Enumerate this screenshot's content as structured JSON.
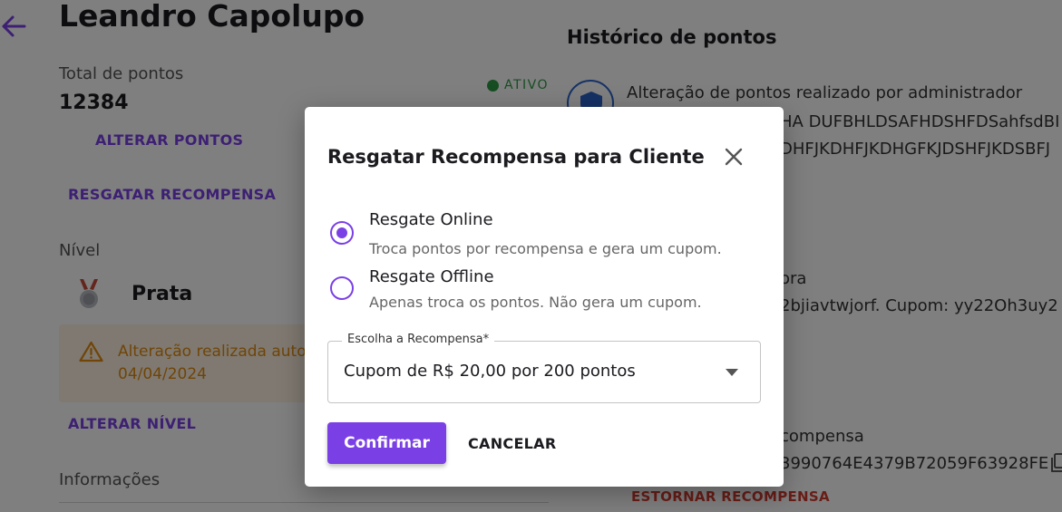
{
  "customer": {
    "name": "Leandro Capolupo",
    "total_points_label": "Total de pontos",
    "total_points_value": "12384",
    "status": "ATIVO",
    "status_color": "#2e9a47"
  },
  "actions": {
    "alter_points": "ALTERAR PONTOS",
    "redeem_reward": "RESGATAR RECOMPENSA",
    "alter_level": "ALTERAR NÍVEL"
  },
  "level": {
    "label": "Nível",
    "name": "Prata",
    "notice_line1": "Alteração realizada autom",
    "notice_line2": "04/04/2024"
  },
  "info": {
    "label": "Informações"
  },
  "history": {
    "title": "Histórico de pontos",
    "entry1_title": "Alteração de pontos realizado por administrador",
    "entry1_line2": "HA DUFBHLDSAFHDSHFDSahfsdBI",
    "entry1_line3": "DHFJKDHFJKDHGFKJDSHFJKDSBFJ",
    "entry2_title_fragment": "ora",
    "entry2_detail_fragment": "2bjiavtwjorf. Cupom: yy22Oh3uy2",
    "entry3_title_fragment": "compensa",
    "entry3_code_fragment": "3990764E4379B72059F63928FE",
    "undo_label": "ESTORNAR RECOMPENSA"
  },
  "dialog": {
    "title": "Resgatar Recompensa para Cliente",
    "option_online_label": "Resgate Online",
    "option_online_desc": "Troca pontos por recompensa e gera um cupom.",
    "option_offline_label": "Resgate Offline",
    "option_offline_desc": "Apenas troca os pontos. Não gera um cupom.",
    "selected_option": "Resgate Online",
    "select_label": "Escolha a Recompensa*",
    "select_value": "Cupom de R$ 20,00 por 200 pontos",
    "confirm_label": "Confirmar",
    "cancel_label": "CANCELAR"
  },
  "colors": {
    "accent": "#7a40e6",
    "warning": "#e18b0f",
    "danger": "#d23a2f",
    "history_icon": "#2a62c9"
  },
  "icons": {
    "back": "arrow-left-icon",
    "medal": "medal-icon",
    "warning": "warning-icon",
    "history": "shield-icon",
    "copy": "copy-icon",
    "close": "close-icon",
    "caret": "caret-down-icon"
  }
}
